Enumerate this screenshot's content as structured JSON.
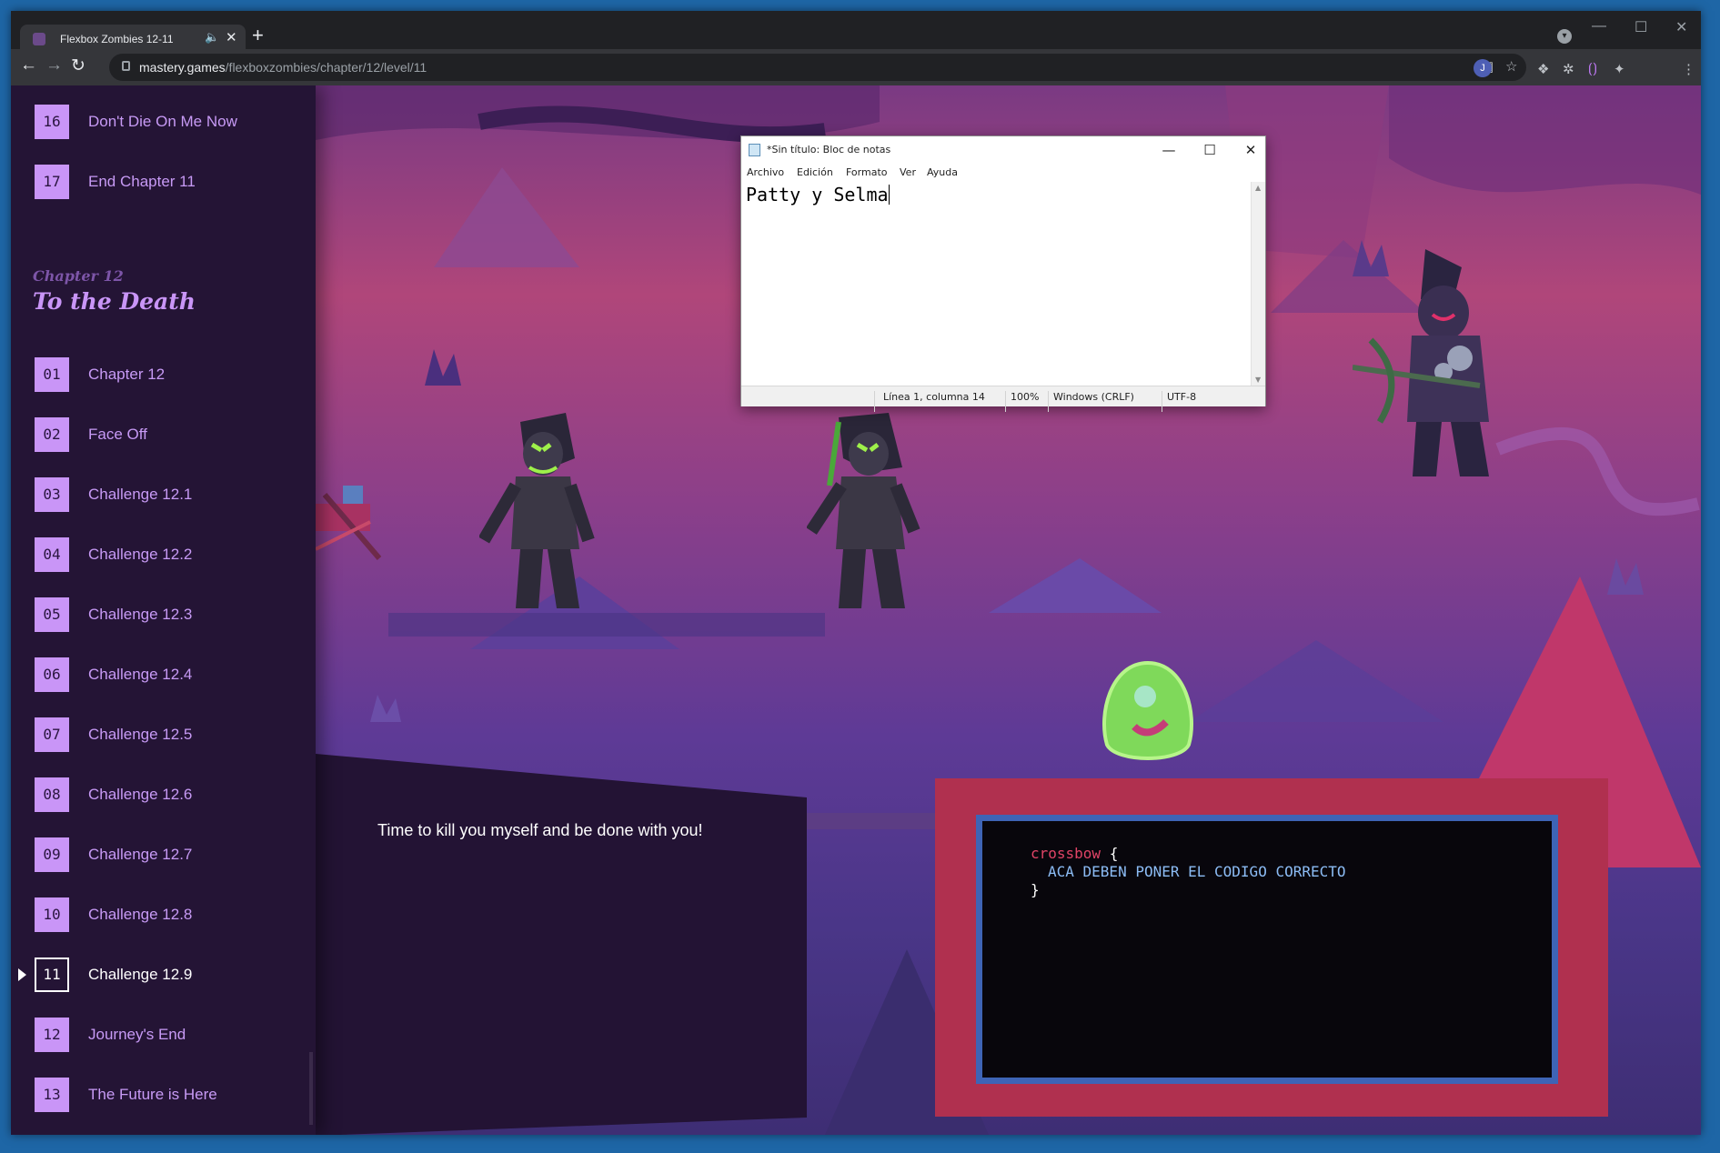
{
  "browser": {
    "tab_title": "Flexbox Zombies 12-11",
    "url_host": "mastery.games",
    "url_path": "/flexboxzombies/chapter/12/level/11",
    "profile_initial": "J"
  },
  "sidebar": {
    "prev_items": [
      {
        "num": "16",
        "label": "Don't Die On Me Now"
      },
      {
        "num": "17",
        "label": "End Chapter 11"
      }
    ],
    "chapter_kicker": "Chapter 12",
    "chapter_title": "To the Death",
    "items": [
      {
        "num": "01",
        "label": "Chapter 12"
      },
      {
        "num": "02",
        "label": "Face Off"
      },
      {
        "num": "03",
        "label": "Challenge 12.1"
      },
      {
        "num": "04",
        "label": "Challenge 12.2"
      },
      {
        "num": "05",
        "label": "Challenge 12.3"
      },
      {
        "num": "06",
        "label": "Challenge 12.4"
      },
      {
        "num": "07",
        "label": "Challenge 12.5"
      },
      {
        "num": "08",
        "label": "Challenge 12.6"
      },
      {
        "num": "09",
        "label": "Challenge 12.7"
      },
      {
        "num": "10",
        "label": "Challenge 12.8"
      },
      {
        "num": "11",
        "label": "Challenge 12.9"
      },
      {
        "num": "12",
        "label": "Journey's End"
      },
      {
        "num": "13",
        "label": "The Future is Here"
      }
    ],
    "active_item": "11"
  },
  "game": {
    "dialog_text": "Time to kill you myself and be done with you!",
    "code": {
      "selector": "crossbow",
      "open_brace": "{",
      "body": "ACA DEBEN PONER EL CODIGO CORRECTO",
      "close_brace": "}"
    }
  },
  "notepad": {
    "title": "*Sin título: Bloc de notas",
    "menu": [
      "Archivo",
      "Edición",
      "Formato",
      "Ver",
      "Ayuda"
    ],
    "content": "Patty y Selma",
    "status": {
      "position": "Línea 1, columna 14",
      "zoom": "100%",
      "line_endings": "Windows (CRLF)",
      "encoding": "UTF-8"
    }
  },
  "colors": {
    "sidebar_bg": "#241435",
    "level_badge": "#c995f7",
    "code_selector": "#e04466",
    "code_body": "#8cbcf5",
    "editor_border": "#3e64b6"
  }
}
